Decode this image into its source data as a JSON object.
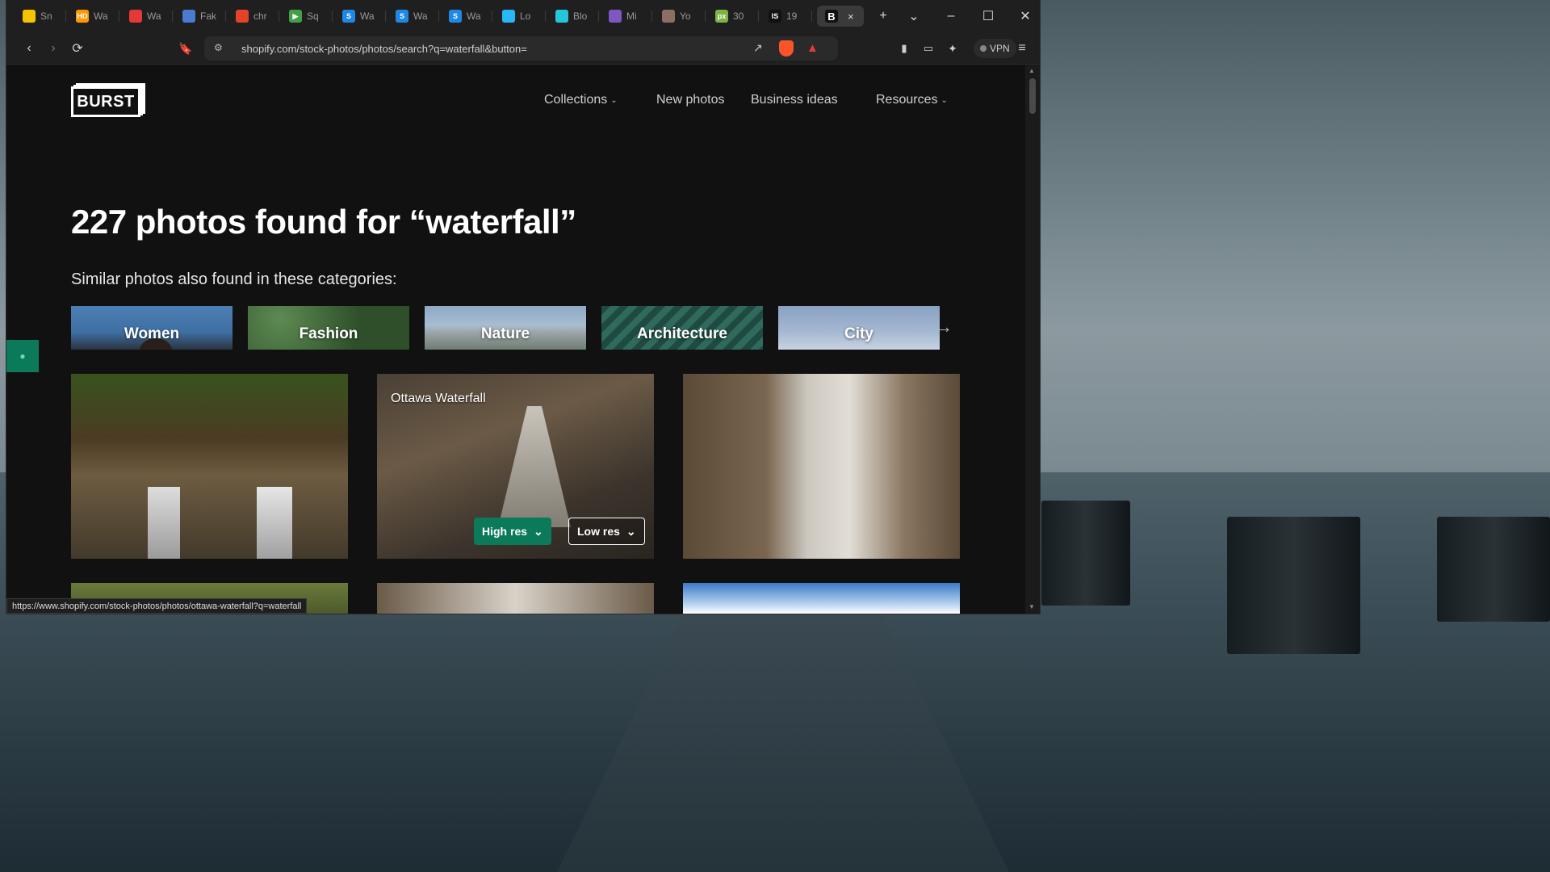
{
  "browser": {
    "tabs": [
      {
        "label": "Sn",
        "fav_color": "#f5c400",
        "fav_text": ""
      },
      {
        "label": "Wa",
        "fav_color": "#ff9800",
        "fav_text": "HD"
      },
      {
        "label": "Wa",
        "fav_color": "#e53935",
        "fav_text": ""
      },
      {
        "label": "Fak",
        "fav_color": "#4a7bd1",
        "fav_text": ""
      },
      {
        "label": "chr",
        "fav_color": "#e24329",
        "fav_text": ""
      },
      {
        "label": "Sq",
        "fav_color": "#43a047",
        "fav_text": "▶"
      },
      {
        "label": "Wa",
        "fav_color": "#1e88e5",
        "fav_text": "S"
      },
      {
        "label": "Wa",
        "fav_color": "#1e88e5",
        "fav_text": "S"
      },
      {
        "label": "Wa",
        "fav_color": "#1e88e5",
        "fav_text": "S"
      },
      {
        "label": "Lo",
        "fav_color": "#29b6f6",
        "fav_text": ""
      },
      {
        "label": "Blo",
        "fav_color": "#26c6da",
        "fav_text": ""
      },
      {
        "label": "Mi",
        "fav_color": "#7e57c2",
        "fav_text": ""
      },
      {
        "label": "Yo",
        "fav_color": "#8d6e63",
        "fav_text": ""
      },
      {
        "label": "30",
        "fav_color": "#7cb342",
        "fav_text": "px"
      },
      {
        "label": "19",
        "fav_color": "#111111",
        "fav_text": "IS"
      }
    ],
    "active_tab": {
      "label": "",
      "fav_text": "B",
      "close": "×"
    },
    "new_tab": "+",
    "url": "shopify.com/stock-photos/photos/search?q=waterfall&button=",
    "vpn_label": "VPN",
    "status_url": "https://www.shopify.com/stock-photos/photos/ottawa-waterfall?q=waterfall"
  },
  "site": {
    "logo": "BURST",
    "nav": [
      {
        "label": "Collections",
        "has_dropdown": true
      },
      {
        "label": "New photos",
        "has_dropdown": false
      },
      {
        "label": "Business ideas",
        "has_dropdown": false
      },
      {
        "label": "Resources",
        "has_dropdown": true
      }
    ],
    "headline": "227 photos found for “waterfall”",
    "subhead": "Similar photos also found in these categories:",
    "categories": [
      "Women",
      "Fashion",
      "Nature",
      "Architecture",
      "City"
    ],
    "photos": [
      {
        "title": ""
      },
      {
        "title": "Ottawa Waterfall",
        "high_res": "High res",
        "low_res": "Low res"
      },
      {
        "title": ""
      }
    ]
  },
  "colors": {
    "accent": "#0b7a5b",
    "background": "#111111"
  }
}
